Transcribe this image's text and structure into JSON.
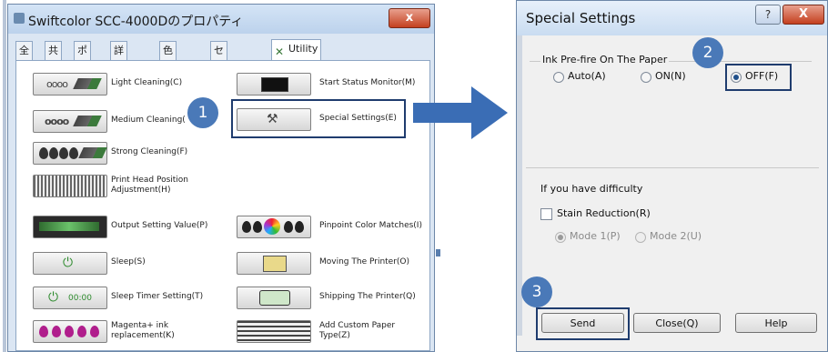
{
  "left_window": {
    "title": "Swiftcolor SCC-4000Dのプロパティ",
    "close": "x",
    "tabs": [
      "全般",
      "共有",
      "ポート",
      "詳細設定",
      "色の管理",
      "セキュリティ",
      "Utility"
    ],
    "items": {
      "light_cleaning": "Light Cleaning(C)",
      "medium_cleaning": "Medium Cleaning(",
      "strong_cleaning": "Strong Cleaning(F)",
      "print_head_line1": "Print Head Position",
      "print_head_line2": "Adjustment(H)",
      "output_setting": "Output Setting Value(P)",
      "sleep": "Sleep(S)",
      "sleep_timer": "Sleep Timer Setting(T)",
      "magenta_line1": "Magenta+ ink",
      "magenta_line2": "replacement(K)",
      "start_status": "Start Status Monitor(M)",
      "special_settings": "Special Settings(E)",
      "pinpoint": "Pinpoint Color Matches(I)",
      "moving": "Moving The Printer(O)",
      "shipping": "Shipping The Printer(Q)",
      "custom_paper_line1": "Add Custom Paper",
      "custom_paper_line2": "Type(Z)"
    },
    "light_dots": "oooo",
    "medium_dots": "oooo",
    "sleep_timer_text": "00:00"
  },
  "callouts": [
    "1",
    "2",
    "3"
  ],
  "dialog": {
    "title": "Special Settings",
    "help_glyph": "?",
    "close": "X",
    "group_label": "Ink Pre-fire On The Paper",
    "options": {
      "auto": "Auto(A)",
      "on": "ON(N)",
      "off": "OFF(F)"
    },
    "selected": "OFF(F)",
    "difficulty_label": "If you have difficulty",
    "stain_reduction": "Stain Reduction(R)",
    "mode1": "Mode 1(P)",
    "mode2": "Mode 2(U)",
    "buttons": {
      "send": "Send",
      "close": "Close(Q)",
      "help": "Help"
    }
  },
  "colors": {
    "highlight": "#1f3c6e",
    "callout": "#4a79b8",
    "arrow": "#3a6db5"
  }
}
